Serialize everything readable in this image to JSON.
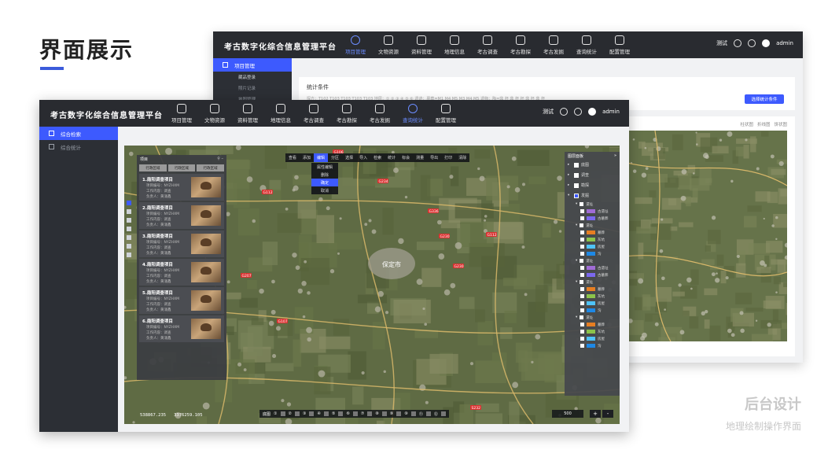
{
  "presentation": {
    "title": "界面展示",
    "corner_title": "后台设计",
    "corner_subtitle": "地理绘制操作界面"
  },
  "colors": {
    "accent": "#3d5afe",
    "topbar": "#292b30",
    "sidebar": "#2c2f35"
  },
  "back_window": {
    "app_title": "考古数字化综合信息管理平台",
    "nav": [
      {
        "label": "项目管理",
        "icon": "grid-icon",
        "active": true
      },
      {
        "label": "文物资源",
        "icon": "vessel-icon",
        "active": false
      },
      {
        "label": "资料管理",
        "icon": "document-icon",
        "active": false
      },
      {
        "label": "地理信息",
        "icon": "globe-icon",
        "active": false
      },
      {
        "label": "考古调查",
        "icon": "edit-icon",
        "active": false
      },
      {
        "label": "考古勘探",
        "icon": "grid-icon",
        "active": false
      },
      {
        "label": "考古发掘",
        "icon": "shovel-icon",
        "active": false
      },
      {
        "label": "查询统计",
        "icon": "pie-icon",
        "active": false
      },
      {
        "label": "配置管理",
        "icon": "sliders-icon",
        "active": false
      }
    ],
    "user": {
      "test_label": "测试",
      "name": "admin"
    },
    "sidebar": {
      "main_item": "项目管理",
      "sub_items": [
        "藏品登录",
        "照片记录",
        "地图管理"
      ]
    },
    "stat_conditions_label": "统计条件",
    "stat_filters": "探方：T102  T103  T103  T103  T103      地层：①  ②  ③  ④  ⑤  ⑥      遗迹：墓葬=M1  M4  M5  M3  M4  M5      遗物：陶=鼎  杯  鼎  杯  杯  鼎  杯  鼎  杯",
    "stat_button": "选择统计条件",
    "chart_tabs": [
      "柱状图",
      "折线图",
      "饼状图"
    ]
  },
  "front_window": {
    "app_title": "考古数字化综合信息管理平台",
    "nav": [
      {
        "label": "项目管理",
        "icon": "grid-icon",
        "active": false
      },
      {
        "label": "文物资源",
        "icon": "vessel-icon",
        "active": false
      },
      {
        "label": "资料管理",
        "icon": "document-icon",
        "active": false
      },
      {
        "label": "地理信息",
        "icon": "globe-icon",
        "active": false
      },
      {
        "label": "考古调查",
        "icon": "edit-icon",
        "active": false
      },
      {
        "label": "考古勘探",
        "icon": "layers-icon",
        "active": false
      },
      {
        "label": "考古发掘",
        "icon": "shovel-icon",
        "active": false
      },
      {
        "label": "查询统计",
        "icon": "pie-icon",
        "active": true
      },
      {
        "label": "配置管理",
        "icon": "sliders-icon",
        "active": false
      }
    ],
    "user": {
      "test_label": "测试",
      "name": "admin"
    },
    "sidebar": {
      "items": [
        {
          "label": "综合检索",
          "active": true
        },
        {
          "label": "综合统计",
          "active": false
        }
      ]
    },
    "toolbar": [
      "查看",
      "添加",
      "编辑",
      "分区",
      "选择",
      "导入",
      "检索",
      "统计",
      "标会",
      "测量",
      "导出",
      "打印",
      "清除"
    ],
    "toolbar_active": "编辑",
    "edit_menu": [
      {
        "label": "属性编辑",
        "active": false
      },
      {
        "label": "删除",
        "active": false
      },
      {
        "label": "确定",
        "active": true
      },
      {
        "label": "取消",
        "active": false
      }
    ],
    "project_panel": {
      "title": "项目",
      "filters": [
        "行政区域",
        "行政区域",
        "行政区域"
      ],
      "cards": [
        {
          "title": "1.南阳调查项目",
          "code": "项目编号：NYZHXM",
          "work": "工作内容：调查",
          "owner": "负责人：黄涌鑫"
        },
        {
          "title": "2.南阳调查项目",
          "code": "项目编号：NYZHXM",
          "work": "工作内容：调查",
          "owner": "负责人：黄涌鑫"
        },
        {
          "title": "3.南阳调查项目",
          "code": "项目编号：NYZHXM",
          "work": "工作内容：调查",
          "owner": "负责人：黄涌鑫"
        },
        {
          "title": "4.南阳调查项目",
          "code": "项目编号：NYZHXM",
          "work": "工作内容：调查",
          "owner": "负责人：黄涌鑫"
        },
        {
          "title": "5.南阳调查项目",
          "code": "项目编号：NYZHXM",
          "work": "工作内容：调查",
          "owner": "负责人：黄涌鑫"
        },
        {
          "title": "6.南阳调查项目",
          "code": "项目编号：NYZHXM",
          "work": "工作内容：调查",
          "owner": "负责人：黄涌鑫"
        }
      ]
    },
    "layer_panel": {
      "title": "图层面板",
      "top_rows": [
        {
          "label": "底图",
          "checked": false
        },
        {
          "label": "调查",
          "checked": false
        },
        {
          "label": "勘探",
          "checked": false
        },
        {
          "label": "发掘",
          "checked": true
        }
      ],
      "groups": [
        {
          "label": "遗址",
          "leaves": [
            {
              "label": "古遗址",
              "color": "#a06cd5"
            },
            {
              "label": "古墓葬",
              "color": "#7b68ee"
            }
          ]
        },
        {
          "label": "遗址",
          "leaves": [
            {
              "label": "墓葬",
              "color": "#e67e22"
            },
            {
              "label": "灰坑",
              "color": "#8bc34a"
            },
            {
              "label": "房屋",
              "color": "#4fc3f7"
            },
            {
              "label": "沟",
              "color": "#1e88e5"
            }
          ]
        },
        {
          "label": "遗址",
          "leaves": [
            {
              "label": "古遗址",
              "color": "#a06cd5"
            },
            {
              "label": "古墓葬",
              "color": "#7b68ee"
            }
          ]
        },
        {
          "label": "遗址",
          "leaves": [
            {
              "label": "墓葬",
              "color": "#e67e22"
            },
            {
              "label": "灰坑",
              "color": "#8bc34a"
            },
            {
              "label": "房屋",
              "color": "#4fc3f7"
            },
            {
              "label": "沟",
              "color": "#1e88e5"
            }
          ]
        },
        {
          "label": "遗址",
          "leaves": [
            {
              "label": "墓葬",
              "color": "#e67e22"
            },
            {
              "label": "灰坑",
              "color": "#8bc34a"
            },
            {
              "label": "房屋",
              "color": "#4fc3f7"
            },
            {
              "label": "沟",
              "color": "#1e88e5"
            }
          ]
        }
      ]
    },
    "map": {
      "city_label": "保定市",
      "road_labels": [
        "G106",
        "G234",
        "G112",
        "G207",
        "G230",
        "G112",
        "G336",
        "G230",
        "S232",
        "G107",
        "G106"
      ]
    },
    "coords": {
      "x": "538867.235",
      "y": "3376259.105"
    },
    "base_layer_label": "底图",
    "base_options": [
      "①",
      "②",
      "③",
      "④",
      "⑤",
      "⑥",
      "⑦",
      "⑧",
      "⑨",
      "⑩",
      "⑪",
      "⑫"
    ],
    "scale": "500",
    "zoom_in": "+",
    "zoom_out": "-"
  }
}
